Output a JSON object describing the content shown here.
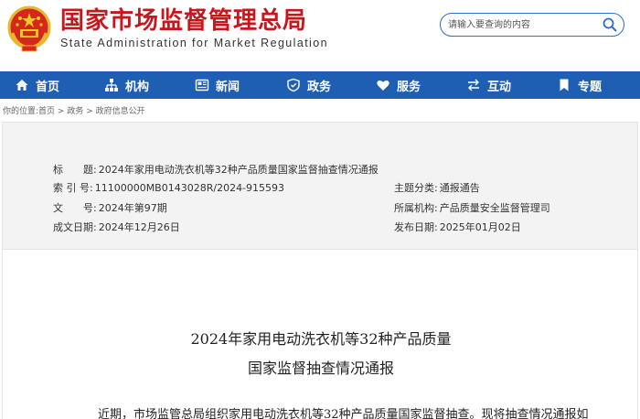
{
  "header": {
    "title": "国家市场监督管理总局",
    "subtitle": "State Administration for Market Regulation",
    "search_placeholder": "请输入要查询的内容"
  },
  "nav": {
    "items": [
      {
        "label": "首页",
        "icon": "home-icon"
      },
      {
        "label": "机构",
        "icon": "org-chart-icon"
      },
      {
        "label": "新闻",
        "icon": "newspaper-icon"
      },
      {
        "label": "政务",
        "icon": "shield-icon"
      },
      {
        "label": "服务",
        "icon": "heart-icon"
      },
      {
        "label": "互动",
        "icon": "exchange-arrows-icon"
      },
      {
        "label": "专题",
        "icon": "bookmark-icon"
      }
    ]
  },
  "breadcrumb": {
    "prefix": "你的位置:",
    "items": [
      "首页",
      "政务",
      "政府信息公开"
    ],
    "separator": " > "
  },
  "info": {
    "title_label": "标　　题:",
    "title_value": "2024年家用电动洗衣机等32种产品质量国家监督抽查情况通报",
    "index_label": "索 引 号:",
    "index_value": "11100000MB0143028R/2024-915593",
    "doc_label": "文　　号:",
    "doc_value": "2024年第97期",
    "date_label": "成文日期:",
    "date_value": "2024年12月26日",
    "category_label": "主题分类:",
    "category_value": "通报通告",
    "org_label": "所属机构:",
    "org_value": "产品质量安全监督管理司",
    "publish_label": "发布日期:",
    "publish_value": "2025年01月02日"
  },
  "article": {
    "title_line1": "2024年家用电动洗衣机等32种产品质量",
    "title_line2": "国家监督抽查情况通报",
    "body_line1": "近期，市场监管总局组织家用电动洗衣机等32种产品质量国家监督抽查。现将抽查情况通报如"
  },
  "colors": {
    "brand_red": "#c8161d",
    "nav_blue": "#1f5fb3",
    "panel_gray": "#f3f3f3"
  }
}
